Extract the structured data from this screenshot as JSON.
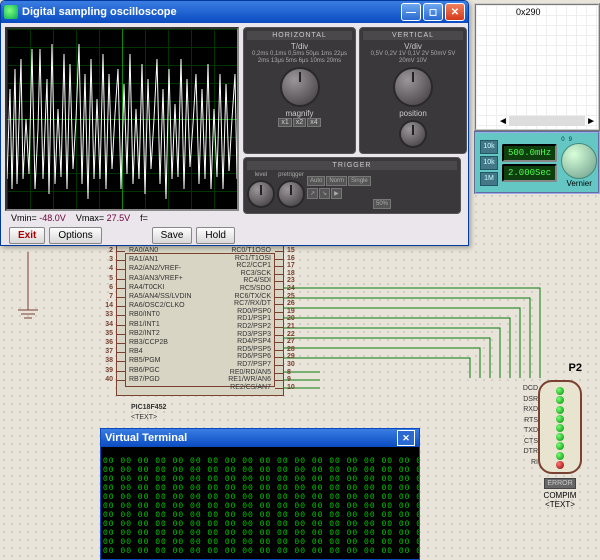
{
  "osc": {
    "title": "Digital sampling oscilloscope",
    "vmin_label": "Vmin=",
    "vmin_value": "-48.0V",
    "vmax_label": "Vmax=",
    "vmax_value": "27.5V",
    "f_label": "f=",
    "f_value": "",
    "buttons": {
      "exit": "Exit",
      "options": "Options",
      "save": "Save",
      "hold": "Hold"
    },
    "horizontal": {
      "header": "HORIZONTAL",
      "title": "T/div",
      "scale": [
        "0,2ms",
        "0,1ms",
        "0,5ms",
        "50μs",
        "1ms",
        "22μs",
        "2ms",
        "13μs",
        "5ms",
        "6μs",
        "10ms",
        "20ms"
      ],
      "magnify_label": "magnify",
      "magnify": [
        "x1",
        "x2",
        "x4"
      ]
    },
    "vertical": {
      "header": "VERTICAL",
      "title": "V/div",
      "scale": [
        "0,5V",
        "0,2V",
        "1V",
        "0,1V",
        "2V",
        "50mV",
        "5V",
        "20mV",
        "10V"
      ],
      "position_label": "position"
    },
    "trigger": {
      "header": "TRIGGER",
      "level": "level",
      "pretrigger": "pretrigger",
      "modes": [
        "Auto",
        "Norm",
        "Single"
      ],
      "fifty": "50%"
    }
  },
  "siggen": {
    "addr": "0x290",
    "freq": "500.0mHz",
    "time": "2.000Sec",
    "vernier": "Vernier",
    "btns": [
      "10k",
      "10k",
      "1M"
    ]
  },
  "pic": {
    "name": "PIC18F452",
    "text_placeholder": "<TEXT>",
    "left_pins": [
      {
        "n": "2",
        "lbl": "RA0/AN0"
      },
      {
        "n": "3",
        "lbl": "RA1/AN1"
      },
      {
        "n": "4",
        "lbl": "RA2/AN2/VREF-"
      },
      {
        "n": "5",
        "lbl": "RA3/AN3/VREF+"
      },
      {
        "n": "6",
        "lbl": "RA4/T0CKI"
      },
      {
        "n": "7",
        "lbl": "RA5/AN4/SS/LVDIN"
      },
      {
        "n": "14",
        "lbl": "RA6/OSC2/CLKO"
      },
      {
        "n": "33",
        "lbl": "RB0/INT0"
      },
      {
        "n": "34",
        "lbl": "RB1/INT1"
      },
      {
        "n": "35",
        "lbl": "RB2/INT2"
      },
      {
        "n": "36",
        "lbl": "RB3/CCP2B"
      },
      {
        "n": "37",
        "lbl": "RB4"
      },
      {
        "n": "38",
        "lbl": "RB5/PGM"
      },
      {
        "n": "39",
        "lbl": "RB6/PGC"
      },
      {
        "n": "40",
        "lbl": "RB7/PGD"
      }
    ],
    "right_pins": [
      {
        "n": "15",
        "lbl": "RC0/T1OSO"
      },
      {
        "n": "16",
        "lbl": "RC1/T1OSI"
      },
      {
        "n": "17",
        "lbl": "RC2/CCP1"
      },
      {
        "n": "18",
        "lbl": "RC3/SCK"
      },
      {
        "n": "23",
        "lbl": "RC4/SDI"
      },
      {
        "n": "24",
        "lbl": "RC5/SDO"
      },
      {
        "n": "25",
        "lbl": "RC6/TX/CK"
      },
      {
        "n": "26",
        "lbl": "RC7/RX/DT"
      },
      {
        "n": "19",
        "lbl": "RD0/PSP0"
      },
      {
        "n": "20",
        "lbl": "RD1/PSP1"
      },
      {
        "n": "21",
        "lbl": "RD2/PSP2"
      },
      {
        "n": "22",
        "lbl": "RD3/PSP3"
      },
      {
        "n": "27",
        "lbl": "RD4/PSP4"
      },
      {
        "n": "28",
        "lbl": "RD5/PSP5"
      },
      {
        "n": "29",
        "lbl": "RD6/PSP6"
      },
      {
        "n": "30",
        "lbl": "RD7/PSP7"
      },
      {
        "n": "8",
        "lbl": "RE0/RD/AN5"
      },
      {
        "n": "9",
        "lbl": "RE1/WR/AN6"
      },
      {
        "n": "10",
        "lbl": "RE2/CS/AN7"
      }
    ]
  },
  "vt": {
    "title": "Virtual Terminal",
    "text": "00 00 00 00 00 00 00 00 00 00 00 00 00 00 00 00 00 00 00 00 00 00\n00 00 00 00 00 00 00 00 00 00 00 00 00 00 00 00 00 00 00 00 00 00\n00 00 00 00 00 00 00 00 00 00 00 00 00 00 00 00 00 00 00 00 00 00\n00 00 00 00 00 00 00 00 00 00 00 00 00 00 00 00 00 00 00 00 00 00\n00 00 00 00 00 00 00 00 00 00 00 00 00 00 00 00 00 00 00 00 00 00\n00 00 00 00 00 00 00 00 00 00 00 00 00 00 00 00 00 00 00 00 00 00\n00 00 00 00 00 00 00 00 00 00 00 00 00 00 00 00 00 00 00 00 00 00\n00 00 00 00 00 00 00 00 00 00 00 00 00 00 00 00 00 00 00 00 00 00\n00 00 00 00 00 00 00 00 00 00 00 00 00 00 00 00 00 00 00 00 00 00\n00 00 00 00 00 00 00 00 00 00 00 00 00 00 00 00 00 00 00 00 00 00\n00 00 00 00 00 00 00 00 00 00 00 00 00 00 00 00 00 00 00 00 00 00"
  },
  "comport": {
    "ref": "P2",
    "component": "COMPIM",
    "text_placeholder": "<TEXT>",
    "error": "ERROR",
    "signals": [
      "DCD",
      "DSR",
      "RXD",
      "RTS",
      "TXD",
      "CTS",
      "DTR",
      "RI"
    ]
  }
}
